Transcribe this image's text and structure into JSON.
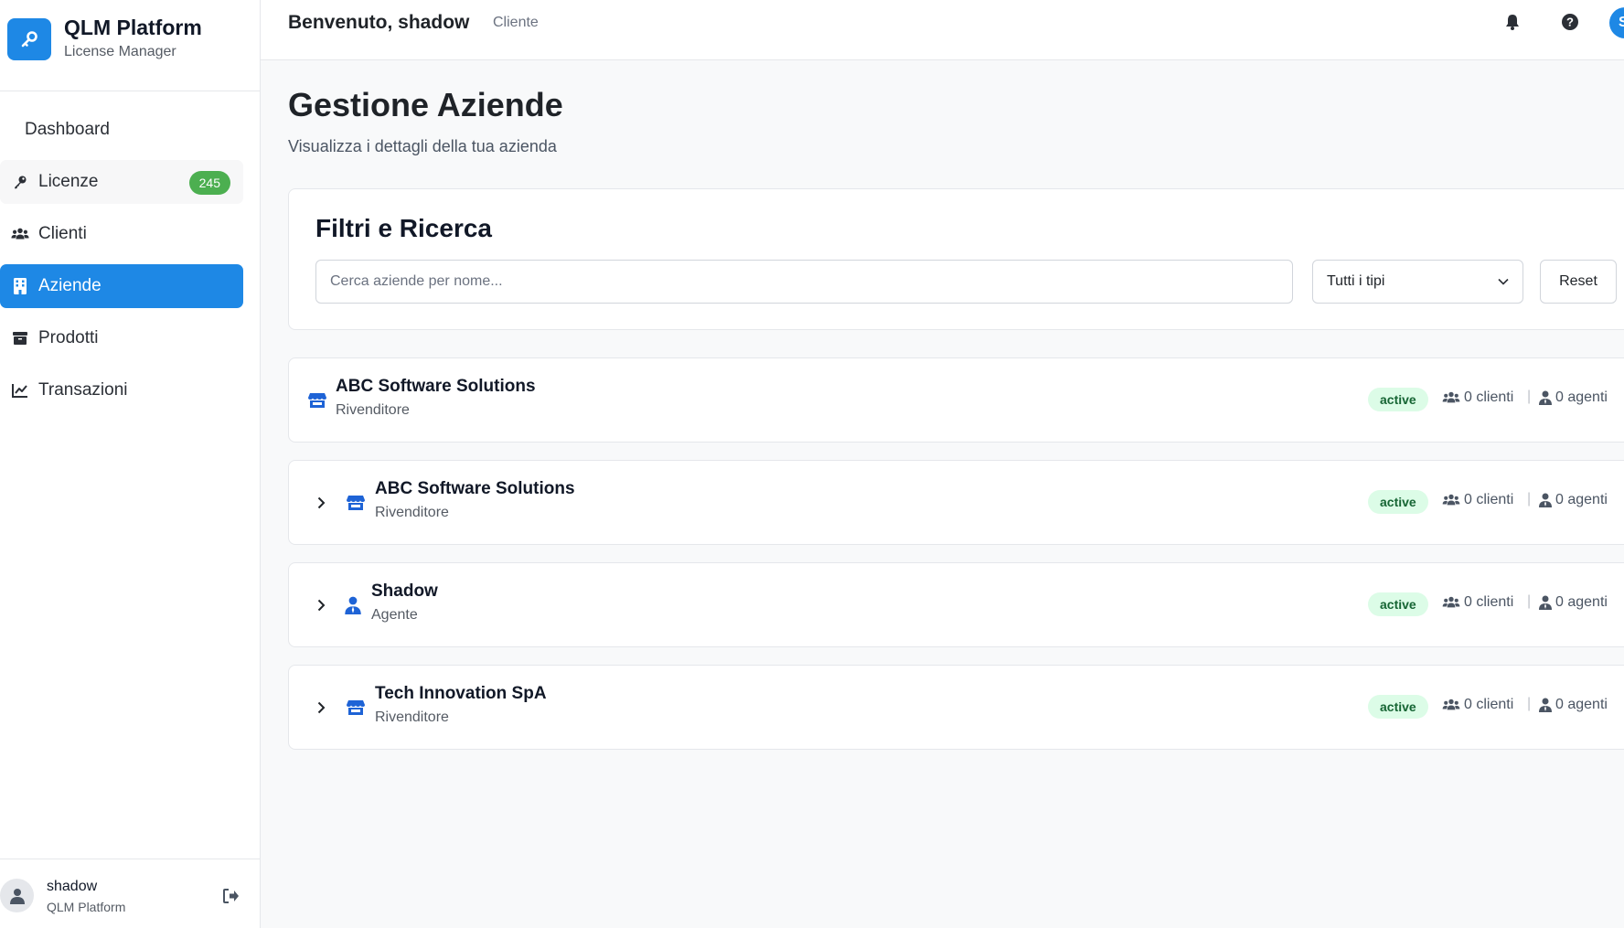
{
  "brand": {
    "title": "QLM Platform",
    "subtitle": "License Manager",
    "logo_icon": "key-icon",
    "color": "#1e88e5"
  },
  "nav": {
    "dashboard": "Dashboard",
    "licenze": "Licenze",
    "licenze_badge": "245",
    "clienti": "Clienti",
    "aziende": "Aziende",
    "prodotti": "Prodotti",
    "transazioni": "Transazioni"
  },
  "user": {
    "name": "shadow",
    "org": "QLM Platform",
    "avatar_initial": "S"
  },
  "header": {
    "welcome": "Benvenuto, shadow",
    "role": "Cliente"
  },
  "page": {
    "title": "Gestione Aziende",
    "subtitle": "Visualizza i dettagli della tua azienda"
  },
  "filters": {
    "title": "Filtri e Ricerca",
    "search_placeholder": "Cerca aziende per nome...",
    "search_value": "",
    "type_selected": "Tutti i tipi",
    "reset_label": "Reset"
  },
  "companies": [
    {
      "name": "ABC Software Solutions",
      "type": "Rivenditore",
      "status": "active",
      "clients": "0 clienti",
      "agents": "0 agenti",
      "icon": "store-icon"
    },
    {
      "name": "ABC Software Solutions",
      "type": "Rivenditore",
      "status": "active",
      "clients": "0 clienti",
      "agents": "0 agenti",
      "icon": "store-icon"
    },
    {
      "name": "Shadow",
      "type": "Agente",
      "status": "active",
      "clients": "0 clienti",
      "agents": "0 agenti",
      "icon": "user-tie-icon"
    },
    {
      "name": "Tech Innovation SpA",
      "type": "Rivenditore",
      "status": "active",
      "clients": "0 clienti",
      "agents": "0 agenti",
      "icon": "store-icon"
    }
  ],
  "colors": {
    "accent": "#1e88e5",
    "badge_green": "#4caf50",
    "status_bg": "#dcfce7",
    "status_text": "#166534"
  }
}
